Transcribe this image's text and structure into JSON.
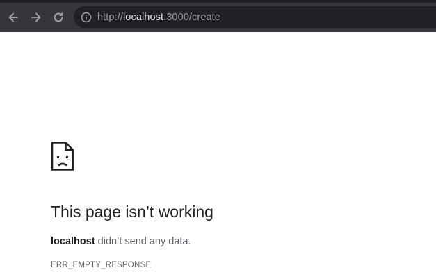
{
  "toolbar": {
    "back_icon": "arrow-left-icon",
    "forward_icon": "arrow-right-icon",
    "reload_icon": "reload-icon",
    "site_info_icon": "info-circle-icon",
    "address": {
      "scheme": "http://",
      "host": "localhost",
      "path": ":3000/create"
    },
    "colors": {
      "toolbar_bg": "#35363a",
      "omnibox_bg": "#202124",
      "icon": "#9aa0a6"
    }
  },
  "error_page": {
    "icon": "sad-document-icon",
    "title": "This page isn’t working",
    "host": "localhost",
    "message": " didn’t send any data.",
    "code": "ERR_EMPTY_RESPONSE"
  }
}
